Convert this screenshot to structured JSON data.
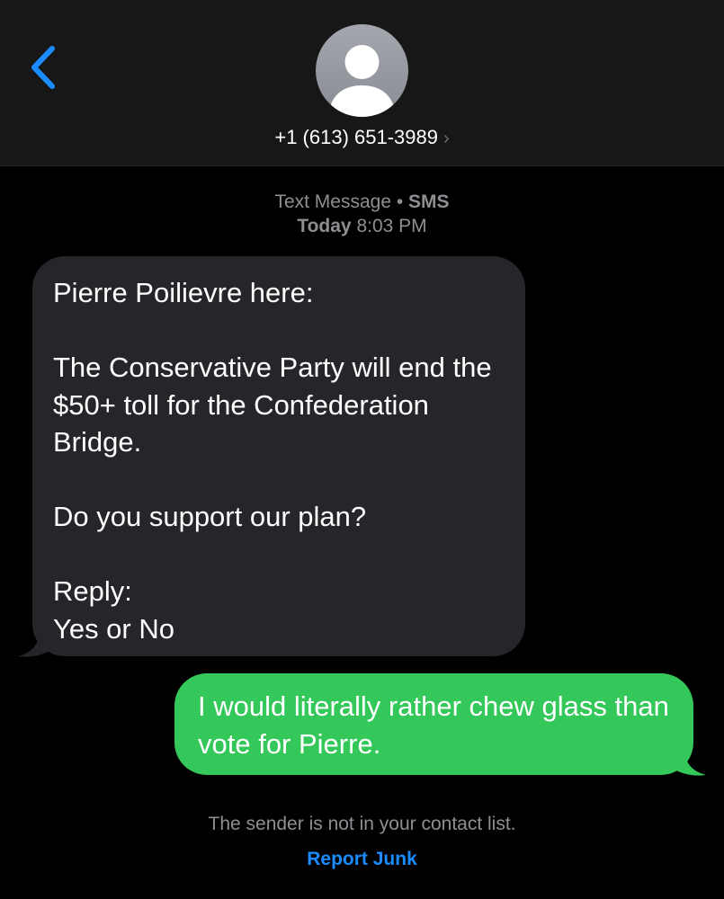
{
  "header": {
    "contact_number": "+1 (613) 651-3989",
    "chevron": "›",
    "back_icon": "chevron-left-icon",
    "avatar_icon": "person-silhouette-icon"
  },
  "conversation": {
    "service_label": "Text Message",
    "separator": "•",
    "service_type": "SMS",
    "day": "Today",
    "time": "8:03 PM",
    "messages": [
      {
        "direction": "incoming",
        "text": "Pierre Poilievre here:\n\nThe Conservative Party will end the $50+ toll for the Confederation Bridge.\n\nDo you support our plan?\n\nReply:\nYes or No"
      },
      {
        "direction": "outgoing",
        "text": "I would literally rather chew glass than vote for Pierre."
      }
    ]
  },
  "footer": {
    "notice": "The sender is not in your contact list.",
    "report_label": "Report Junk"
  },
  "colors": {
    "background": "#000000",
    "header_background": "#171717",
    "incoming_bubble": "#26252a",
    "outgoing_bubble": "#34c759",
    "accent_blue": "#1a8cff",
    "meta_gray": "#8e8e93"
  }
}
